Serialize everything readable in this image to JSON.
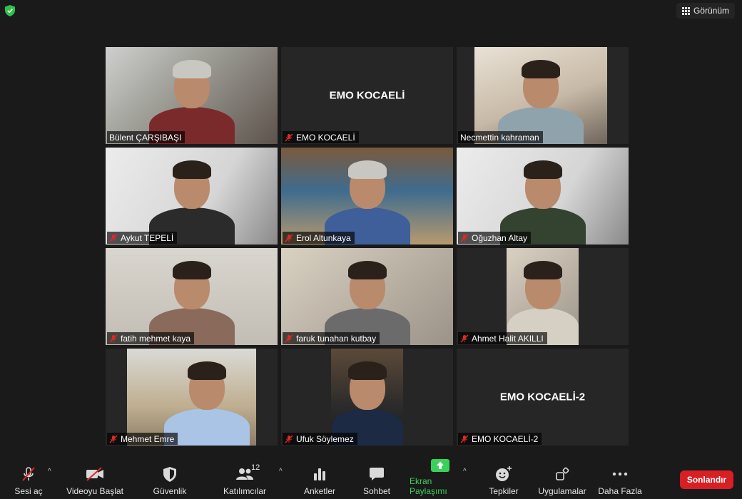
{
  "top": {
    "view_label": "Görünüm"
  },
  "tiles": [
    {
      "name": "Bülent ÇARŞIBAŞI",
      "active": true
    },
    {
      "name": "EMO KOCAELİ",
      "title": "EMO KOCAELİ"
    },
    {
      "name": "Necmettin kahraman"
    },
    {
      "name": "Aykut TEPELİ"
    },
    {
      "name": "Erol Altunkaya"
    },
    {
      "name": "Oğuzhan Altay"
    },
    {
      "name": "fatih mehmet kaya"
    },
    {
      "name": "faruk tunahan kutbay"
    },
    {
      "name": "Ahmet Halit AKILLI"
    },
    {
      "name": "Mehmet Emre"
    },
    {
      "name": "Ufuk Söylemez"
    },
    {
      "name": "EMO KOCAELİ-2",
      "title": "EMO KOCAELİ-2"
    }
  ],
  "toolbar": {
    "unmute": "Sesi aç",
    "start_video": "Videoyu Başlat",
    "security": "Güvenlik",
    "participants": "Katılımcılar",
    "participants_count": "12",
    "polls": "Anketler",
    "chat": "Sohbet",
    "share": "Ekran Paylaşımı",
    "reactions": "Tepkiler",
    "apps": "Uygulamalar",
    "more": "Daha Fazla",
    "end": "Sonlandır"
  },
  "colors": {
    "active_border": "#c6e06a",
    "share_green": "#3ad15b",
    "end_red": "#d71f24",
    "mute_red": "#e02828"
  }
}
